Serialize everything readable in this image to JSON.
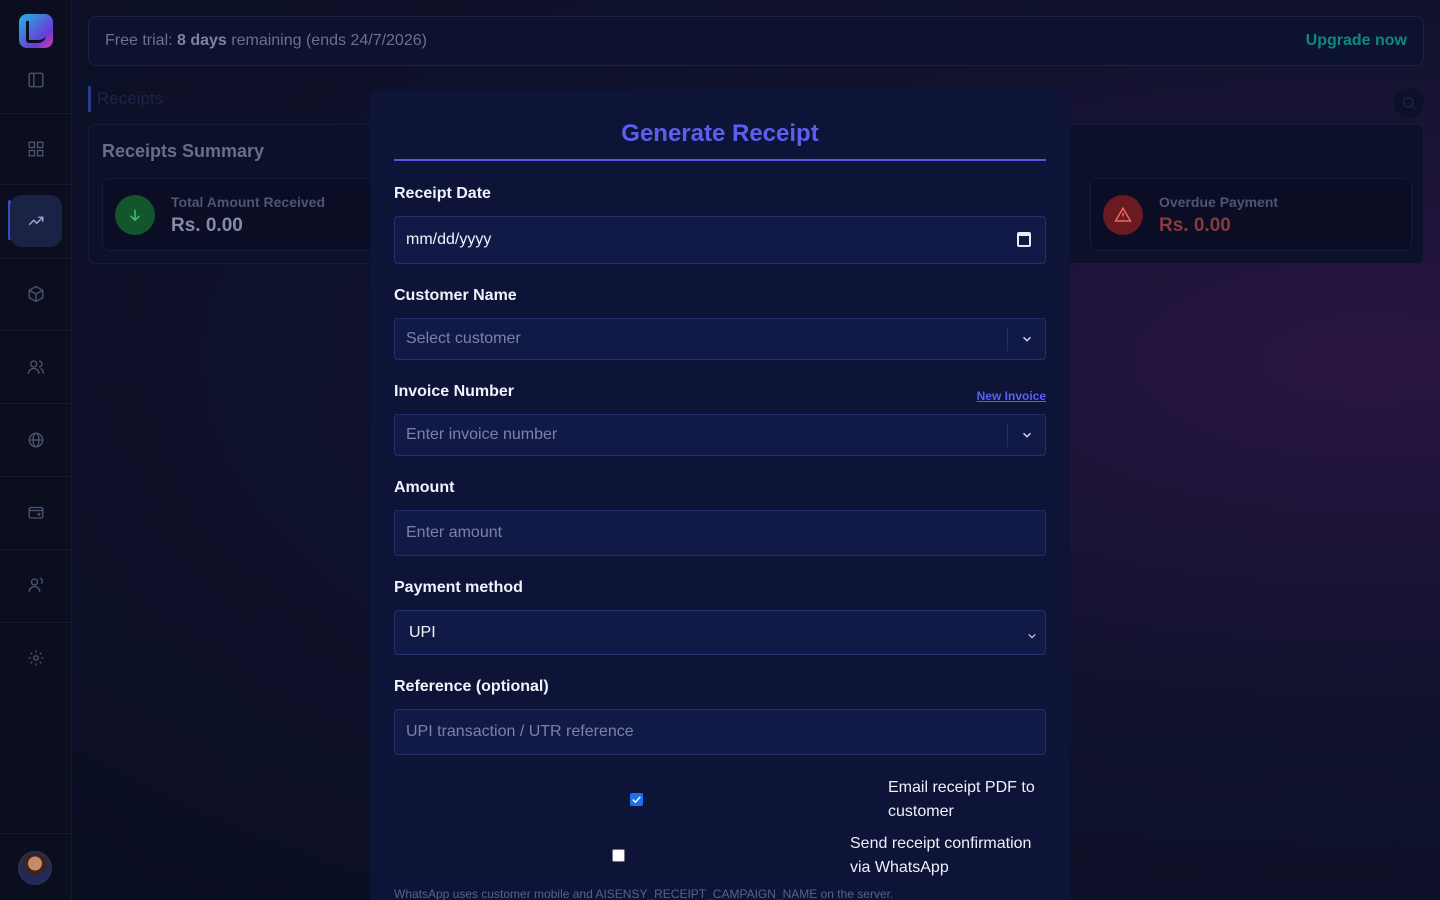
{
  "trial": {
    "prefix": "Free trial: ",
    "days": "8 days",
    "suffix": " remaining (ends 24/7/2026)",
    "upgrade_label": "Upgrade now"
  },
  "breadcrumb": {
    "label": "Receipts"
  },
  "summary": {
    "title": "Receipts Summary",
    "cards": [
      {
        "label": "Total Amount Received",
        "value": "Rs. 0.00",
        "icon": "arrow-down-icon",
        "color": "#1f9a4a"
      },
      {
        "label": "Overdue Payment",
        "value": "Rs. 0.00",
        "icon": "warning-icon",
        "color": "#c53030"
      }
    ]
  },
  "sidebar": {
    "items": [
      {
        "name": "panel-toggle-icon"
      },
      {
        "name": "dashboard-icon"
      },
      {
        "name": "trending-up-icon",
        "active": true
      },
      {
        "name": "box-icon"
      },
      {
        "name": "users-icon"
      },
      {
        "name": "globe-icon"
      },
      {
        "name": "wallet-icon"
      },
      {
        "name": "team-icon"
      },
      {
        "name": "gear-icon"
      }
    ]
  },
  "modal": {
    "title": "Generate Receipt",
    "receipt_date": {
      "label": "Receipt Date",
      "value": "mm/dd/yyyy"
    },
    "customer": {
      "label": "Customer Name",
      "placeholder": "Select customer"
    },
    "invoice": {
      "label": "Invoice Number",
      "placeholder": "Enter invoice number",
      "link": "New Invoice"
    },
    "amount": {
      "label": "Amount",
      "placeholder": "Enter amount"
    },
    "payment_method": {
      "label": "Payment method",
      "value": "UPI"
    },
    "reference": {
      "label": "Reference (optional)",
      "placeholder": "UPI transaction / UTR reference"
    },
    "email_option": {
      "label_line1": "Email receipt PDF to",
      "label_line2": "customer",
      "checked": true
    },
    "whatsapp_option": {
      "label_line1": "Send receipt confirmation",
      "label_line2": "via WhatsApp",
      "checked": false
    },
    "footnote": "WhatsApp uses customer mobile and AISENSY_RECEIPT_CAMPAIGN_NAME on the server."
  },
  "colors": {
    "accent": "#5b5ff0",
    "upgrade": "#0f8a7a",
    "modal_bg": "#0e1438"
  }
}
